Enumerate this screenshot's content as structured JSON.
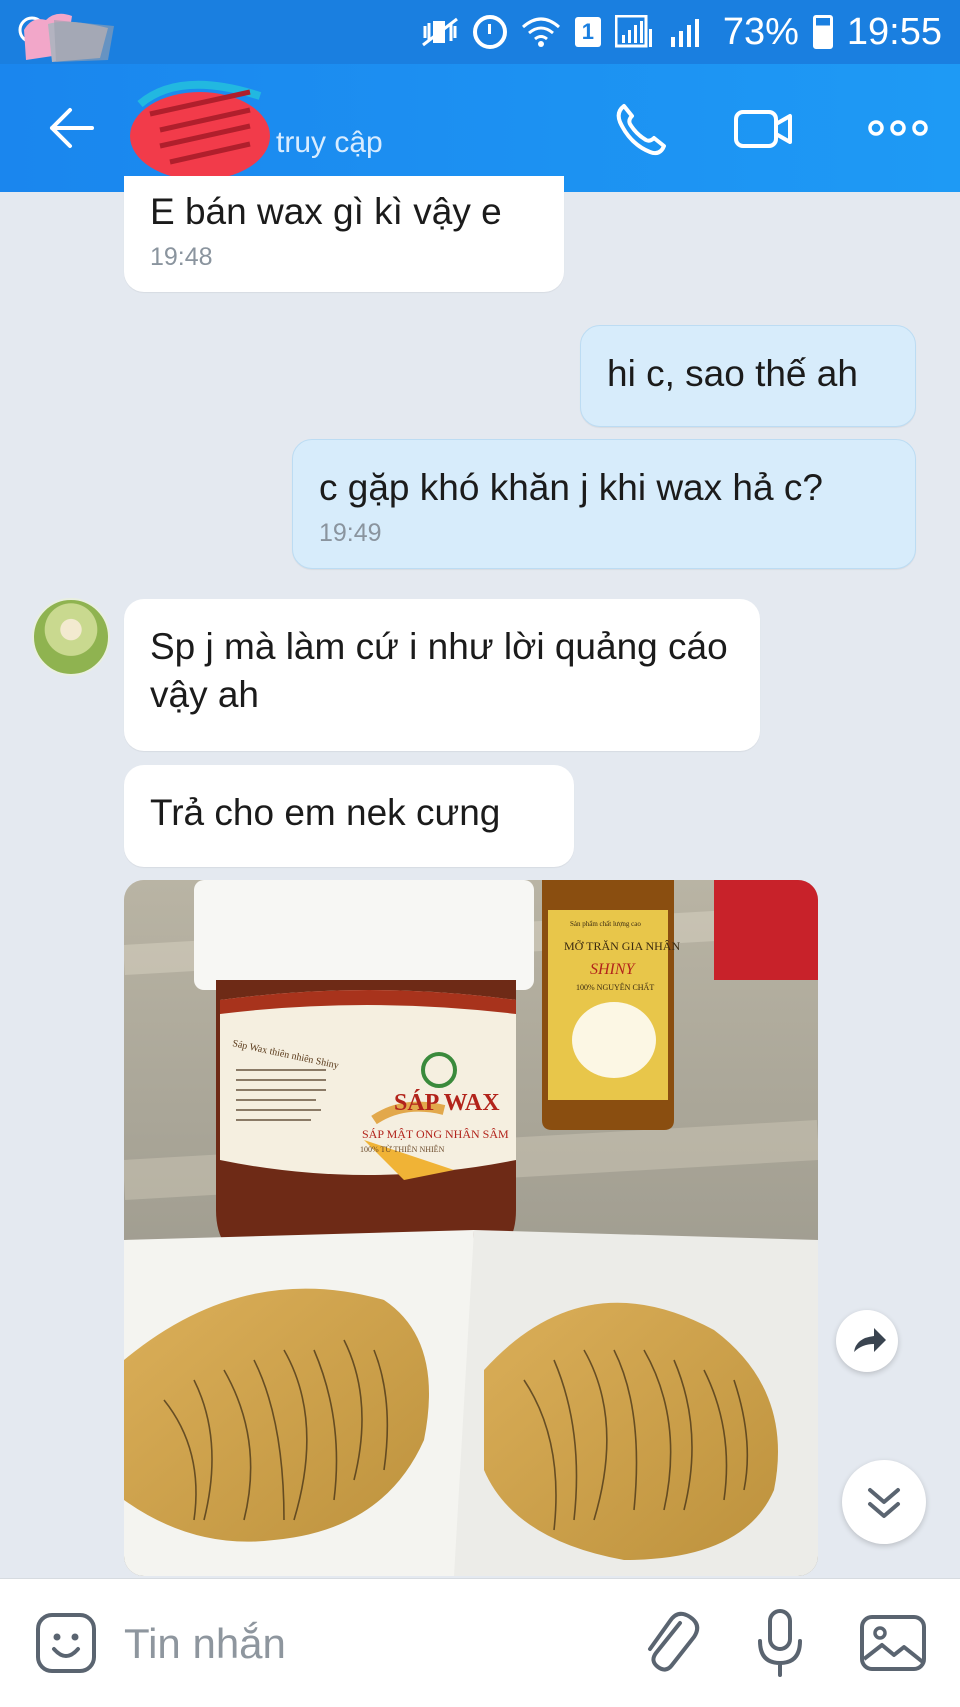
{
  "status_bar": {
    "battery": "73%",
    "time": "19:55",
    "sim_slot": "1"
  },
  "header": {
    "subtitle": "truy cập",
    "icons": [
      "back-arrow-icon",
      "phone-icon",
      "video-camera-icon",
      "more-icon"
    ]
  },
  "messages": [
    {
      "direction": "in",
      "text": "E bán wax gì kì vậy e",
      "time": "19:48"
    },
    {
      "direction": "out",
      "text": "hi c, sao thế ah",
      "time": ""
    },
    {
      "direction": "out",
      "text": "c gặp khó khăn j khi wax hả c?",
      "time": "19:49"
    },
    {
      "direction": "in",
      "text": "Sp j mà làm cứ i như lời quảng cáo vậy ah",
      "time": ""
    },
    {
      "direction": "in",
      "text": "Trả cho em nek cưng",
      "time": ""
    }
  ],
  "photo": {
    "jar_label": "SÁP WAX",
    "jar_sublabel": "SÁP MẬT ONG NHÂN SÂM",
    "jar_side": "Sáp Wax thiên nhiên Shiny",
    "jar_percent": "100% TỪ THIÊN NHIÊN",
    "bottle_label": "MỠ TRĂN GIA NHÂN",
    "bottle_brand": "SHINY",
    "bottle_sub": "100% NGUYÊN CHẤT",
    "bottle_top": "Sản phẩm chất lượng cao"
  },
  "input": {
    "placeholder": "Tin nhắn"
  },
  "colors": {
    "header": "#1a86ee",
    "incoming_bubble": "#ffffff",
    "outgoing_bubble": "#d7ecfb",
    "background": "#e4e9f0"
  }
}
